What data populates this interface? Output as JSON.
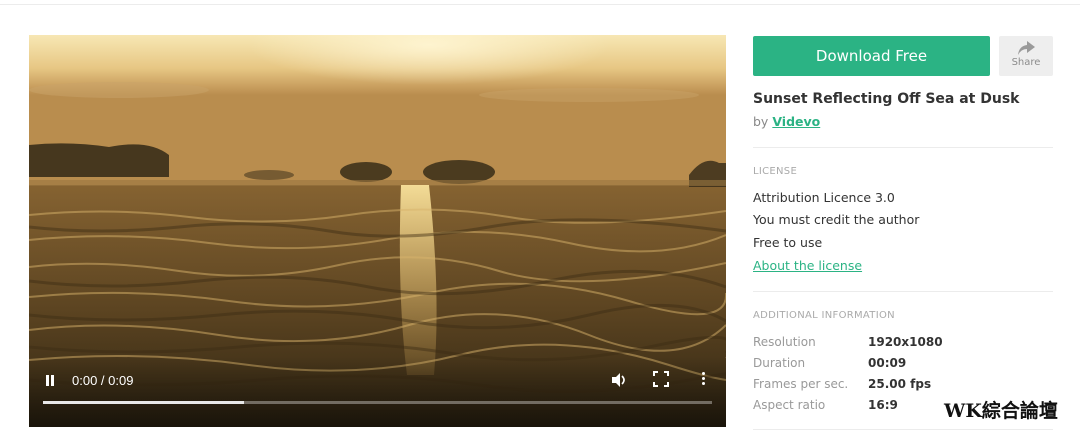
{
  "video": {
    "time_display": "0:00 / 0:09",
    "progress": 0.3,
    "scene": "sunset over rippling sea with dark silhouetted islands"
  },
  "actions": {
    "download_label": "Download Free",
    "share_label": "Share"
  },
  "clip": {
    "title": "Sunset Reflecting Off Sea at Dusk",
    "by_prefix": "by",
    "author": "Videvo"
  },
  "license": {
    "heading": "LICENSE",
    "lines": [
      "Attribution Licence 3.0",
      "You must credit the author",
      "Free to use"
    ],
    "link": "About the license"
  },
  "info": {
    "heading": "ADDITIONAL INFORMATION",
    "rows": [
      {
        "label": "Resolution",
        "value": "1920x1080"
      },
      {
        "label": "Duration",
        "value": "00:09"
      },
      {
        "label": "Frames per sec.",
        "value": "25.00 fps"
      },
      {
        "label": "Aspect ratio",
        "value": "16:9"
      }
    ]
  },
  "watermark": "WK綜合論壇",
  "colors": {
    "accent": "#2bb384",
    "share_bg": "#eeeeee"
  },
  "icons": [
    "pause-icon",
    "volume-icon",
    "fullscreen-icon",
    "more-options-icon",
    "share-icon"
  ]
}
